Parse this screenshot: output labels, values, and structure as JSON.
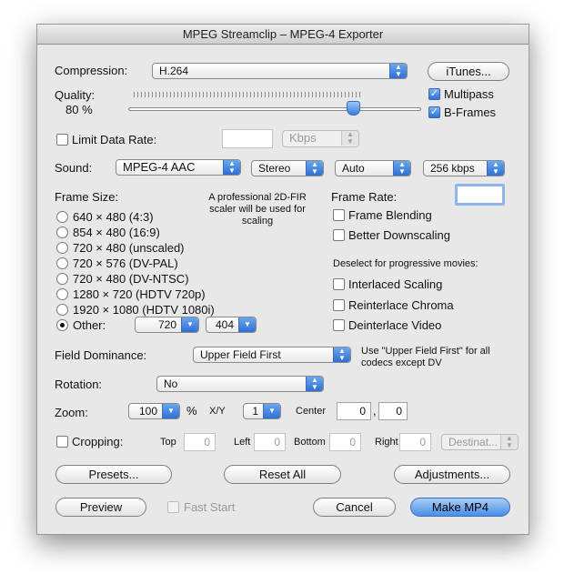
{
  "window": {
    "title": "MPEG Streamclip – MPEG-4 Exporter"
  },
  "compression": {
    "label": "Compression:",
    "value": "H.264"
  },
  "itunes_button": "iTunes...",
  "quality": {
    "label": "Quality:",
    "value_text": "80 %",
    "value": 80
  },
  "multipass": {
    "label": "Multipass",
    "checked": true
  },
  "bframes": {
    "label": "B-Frames",
    "checked": true
  },
  "limit_data_rate": {
    "label": "Limit Data Rate:",
    "value": "",
    "unit": "Kbps"
  },
  "sound": {
    "label": "Sound:",
    "codec": "MPEG-4 AAC",
    "channels": "Stereo",
    "rate": "Auto",
    "bitrate": "256 kbps"
  },
  "frame_size": {
    "label": "Frame Size:",
    "note": "A professional 2D-FIR scaler will be used for scaling",
    "options": [
      "640 × 480  (4:3)",
      "854 × 480  (16:9)",
      "720 × 480  (unscaled)",
      "720 × 576  (DV-PAL)",
      "720 × 480  (DV-NTSC)",
      "1280 × 720  (HDTV 720p)",
      "1920 × 1080  (HDTV 1080i)"
    ],
    "other_label": "Other:",
    "other_width": "720",
    "times": "×",
    "other_height": "404"
  },
  "frame_rate": {
    "label": "Frame Rate:",
    "value": ""
  },
  "frame_blending": "Frame Blending",
  "better_downscaling": "Better Downscaling",
  "progressive_note": "Deselect for progressive movies:",
  "interlaced_scaling": "Interlaced Scaling",
  "reinterlace_chroma": "Reinterlace Chroma",
  "deinterlace_video": "Deinterlace Video",
  "field_dominance": {
    "label": "Field Dominance:",
    "value": "Upper Field First",
    "note": "Use \"Upper Field First\" for all codecs except DV"
  },
  "rotation": {
    "label": "Rotation:",
    "value": "No"
  },
  "zoom": {
    "label": "Zoom:",
    "value": "100",
    "percent": "%",
    "xy_label": "X/Y",
    "xy_value": "1",
    "center_label": "Center",
    "center_x": "0",
    "center_sep": ",",
    "center_y": "0"
  },
  "cropping": {
    "label": "Cropping:",
    "top_label": "Top",
    "top": "0",
    "left_label": "Left",
    "left": "0",
    "bottom_label": "Bottom",
    "bottom": "0",
    "right_label": "Right",
    "right": "0",
    "destination": "Destinat..."
  },
  "buttons": {
    "presets": "Presets...",
    "reset_all": "Reset All",
    "adjustments": "Adjustments...",
    "preview": "Preview",
    "fast_start": "Fast Start",
    "cancel": "Cancel",
    "make_mp4": "Make MP4"
  }
}
